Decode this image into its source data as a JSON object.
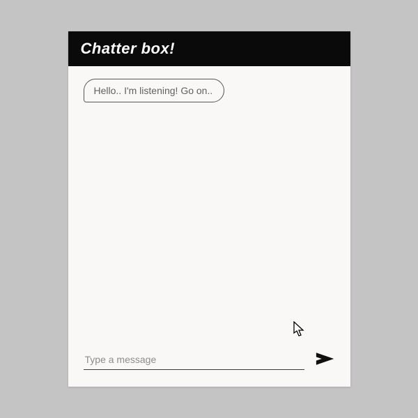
{
  "header": {
    "title": "Chatter box!"
  },
  "messages": [
    {
      "text": "Hello.. I'm listening! Go on.."
    }
  ],
  "input": {
    "placeholder": "Type a message",
    "value": ""
  }
}
